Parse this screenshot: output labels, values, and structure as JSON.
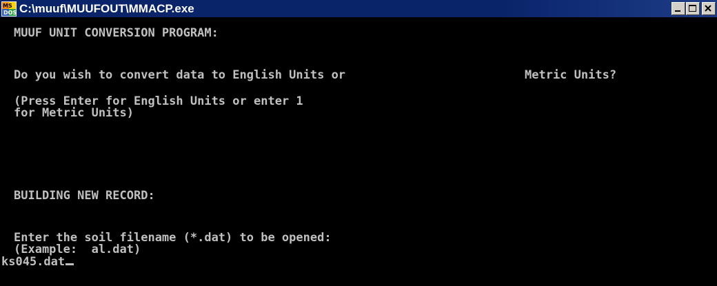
{
  "window": {
    "title": "C:\\muuf\\MUUFOUT\\MMACP.exe",
    "icon": "ms-dos-icon",
    "controls": {
      "minimize": "minimize-icon",
      "maximize": "maximize-icon",
      "close": "close-icon"
    }
  },
  "console": {
    "heading": "MUUF UNIT CONVERSION PROGRAM:",
    "question_left": "Do you wish to convert data to English Units or",
    "question_right": "Metric Units?",
    "hint_line1": "(Press Enter for English Units or enter 1",
    "hint_line2": "for Metric Units)",
    "status": "BUILDING NEW RECORD:",
    "prompt_line1": "Enter the soil filename (*.dat) to be opened:",
    "prompt_line2": "(Example:  al.dat)",
    "input_value": "ks045.dat"
  },
  "colors": {
    "titlebar": "#0a246a",
    "console_bg": "#000000",
    "console_text": "#c0c0c0",
    "button_face": "#d4d0c8"
  }
}
